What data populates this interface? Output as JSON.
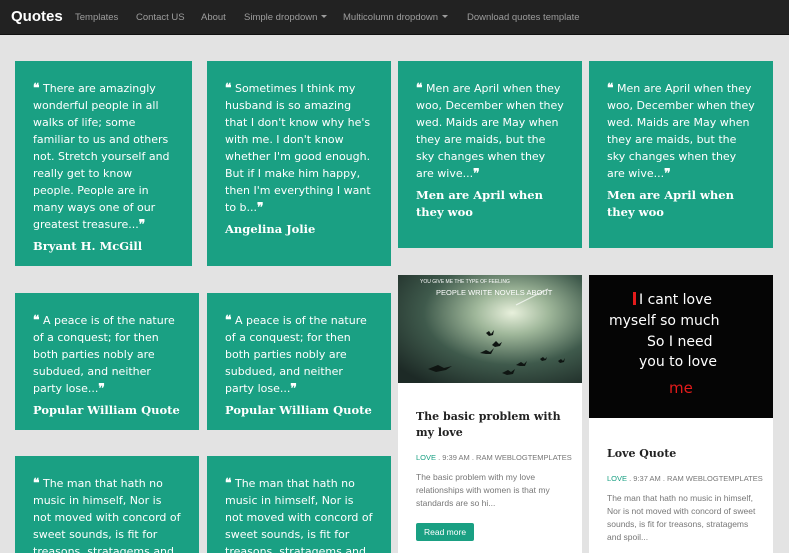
{
  "navbar": {
    "brand": "Quotes",
    "items": [
      "Templates",
      "Contact US",
      "About",
      "Simple dropdown",
      "Multicolumn dropdown",
      "Download quotes template"
    ]
  },
  "quotes": [
    {
      "text": "There are amazingly wonderful people in all walks of life; some familiar to us and others not. Stretch yourself and really get to know people. People are in many ways one of our greatest treasure...",
      "author": "Bryant H. McGill"
    },
    {
      "text": "Sometimes I think my husband is so amazing that I don't know why he's with me. I don't know whether I'm good enough. But if I make him happy, then I'm everything I want to b...",
      "author": "Angelina Jolie"
    },
    {
      "text": "Men are April when they woo, December when they wed. Maids are May when they are maids, but the sky changes when they are wive...",
      "author": "Men are April when they woo"
    },
    {
      "text": "Men are April when they woo, December when they wed. Maids are May when they are maids, but the sky changes when they are wive...",
      "author": "Men are April when they woo"
    },
    {
      "text": "A peace is of the nature of a conquest; for then both parties nobly are subdued, and neither party lose...",
      "author": "Popular William Quote"
    },
    {
      "text": "A peace is of the nature of a conquest; for then both parties nobly are subdued, and neither party lose...",
      "author": "Popular William Quote"
    },
    {
      "text": "The man that hath no music in himself, Nor is not moved with concord of sweet sounds, is fit for treasons, stratagems and",
      "author": ""
    },
    {
      "text": "The man that hath no music in himself, Nor is not moved with concord of sweet sounds, is fit for treasons, stratagems and",
      "author": ""
    }
  ],
  "quote_open": "❝",
  "quote_close": "❞",
  "posts": [
    {
      "image_text": [
        "YOU GIVE ME THE TYPE OF FEELING",
        "PEOPLE WRITE NOVELS ABOUT"
      ],
      "title": "The basic problem with my love",
      "label": "LOVE",
      "meta": " . 9:39 AM . RAM WEBLOGTEMPLATES",
      "excerpt": "The basic problem with my love relationships with women is that my standards are so hi...",
      "button": "Read more"
    },
    {
      "image_text": [
        "I cant love",
        "myself so much",
        "So I need",
        "you to love",
        "me"
      ],
      "title": "Love Quote",
      "label": "LOVE",
      "meta": " . 9:37 AM . RAM WEBLOGTEMPLATES",
      "excerpt": "The man that hath no music in himself, Nor is not moved with concord of sweet sounds, is fit for treasons, stratagems and spoil..."
    }
  ],
  "colors": {
    "accent": "#1aa083",
    "navbar": "#222222",
    "background": "#e3e3e3"
  }
}
